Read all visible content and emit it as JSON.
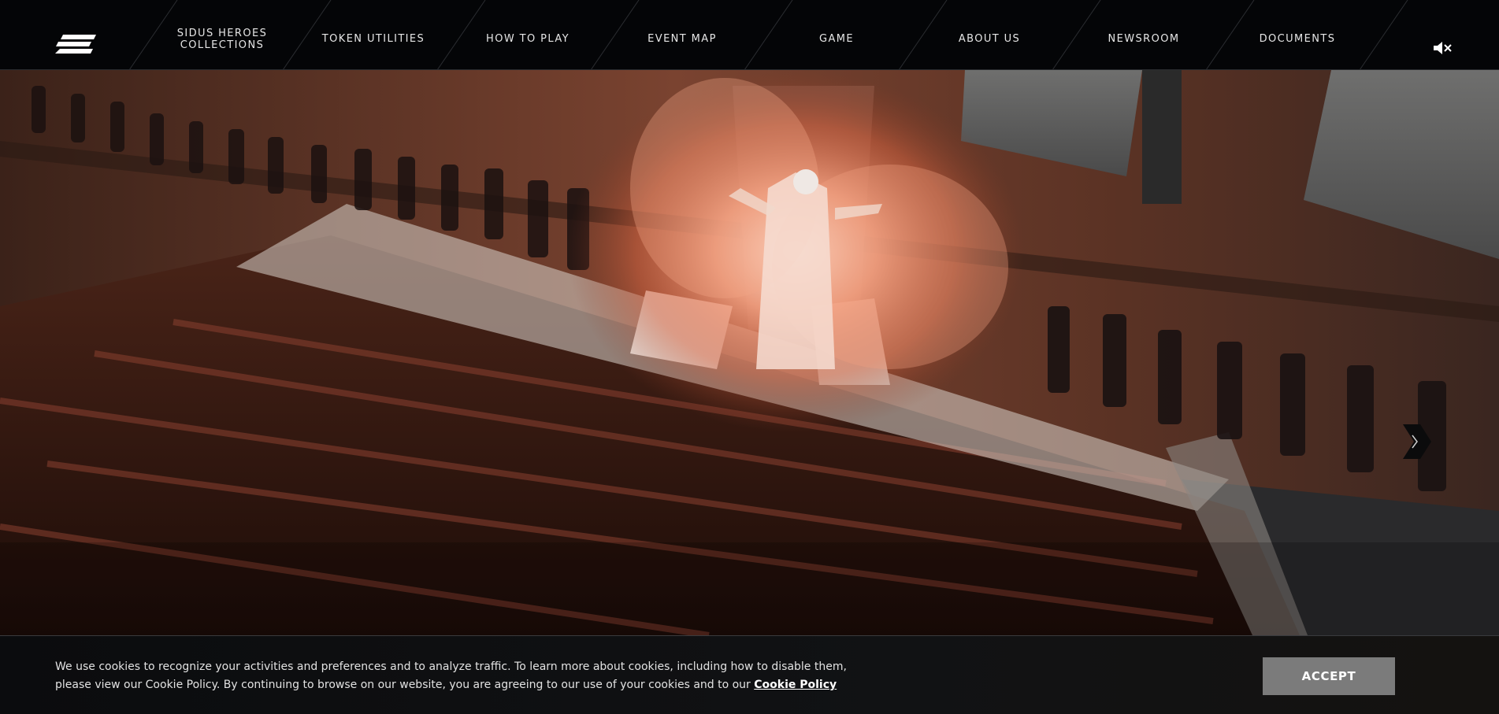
{
  "header": {
    "logo_icon": "stacked-slash-logo-icon",
    "nav": [
      {
        "label": "SIDUS HEROES\nCOLLECTIONS"
      },
      {
        "label": "TOKEN UTILITIES"
      },
      {
        "label": "HOW TO PLAY"
      },
      {
        "label": "EVENT MAP"
      },
      {
        "label": "GAME"
      },
      {
        "label": "ABOUT US"
      },
      {
        "label": "NEWSROOM"
      },
      {
        "label": "DOCUMENTS"
      }
    ],
    "mute_icon": "speaker-muted-icon"
  },
  "hero": {
    "next_icon": "chevron-right-icon",
    "colors": {
      "fire": "#f08a64",
      "wall": "#6b3a2a",
      "stairs": "#3a1c14"
    }
  },
  "cookie": {
    "text_1": "We use cookies to recognize your activities and preferences and to analyze traffic. To learn more about cookies, including how to disable them, please view our Cookie Policy. By continuing to browse on our website, you are agreeing to our use of your cookies and to our ",
    "link": "Cookie Policy",
    "accept": "ACCEPT"
  }
}
